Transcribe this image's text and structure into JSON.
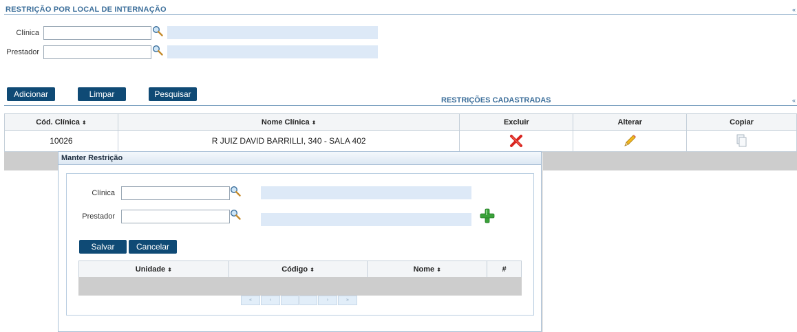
{
  "section": {
    "title": "RESTRIÇÃO POR LOCAL DE INTERNAÇÃO",
    "collapse_mark": "«"
  },
  "filters": {
    "clinica_label": "Clínica",
    "prestador_label": "Prestador"
  },
  "actions": {
    "adicionar": "Adicionar",
    "limpar": "Limpar",
    "pesquisar": "Pesquisar"
  },
  "results": {
    "title": "RESTRIÇÕES CADASTRADAS",
    "collapse_mark": "«",
    "columns": [
      "Cód. Clínica",
      "Nome Clínica",
      "Excluir",
      "Alterar",
      "Copiar"
    ],
    "sort_symbol": "⬍",
    "rows": [
      {
        "codigo": "10026",
        "nome": "R JUIZ DAVID BARRILLI, 340 - SALA 402"
      }
    ]
  },
  "dialog": {
    "title": "Manter Restrição",
    "clinica_label": "Clínica",
    "prestador_label": "Prestador",
    "salvar": "Salvar",
    "cancelar": "Cancelar",
    "columns": [
      "Unidade",
      "Código",
      "Nome",
      "#"
    ],
    "sort_symbol": "⬍",
    "pager": [
      "«",
      "‹",
      "",
      "",
      "›",
      "»"
    ]
  },
  "colors": {
    "button_bg": "#0f4a75",
    "section_title": "#3b6e9a",
    "readonly_field": "#dde9f7",
    "grid_band": "#cdcdcd"
  },
  "icons": {
    "search": "magnifier-icon",
    "delete": "red-x-icon",
    "edit": "pencil-icon",
    "copy": "copy-document-icon",
    "add": "green-plus-icon"
  }
}
